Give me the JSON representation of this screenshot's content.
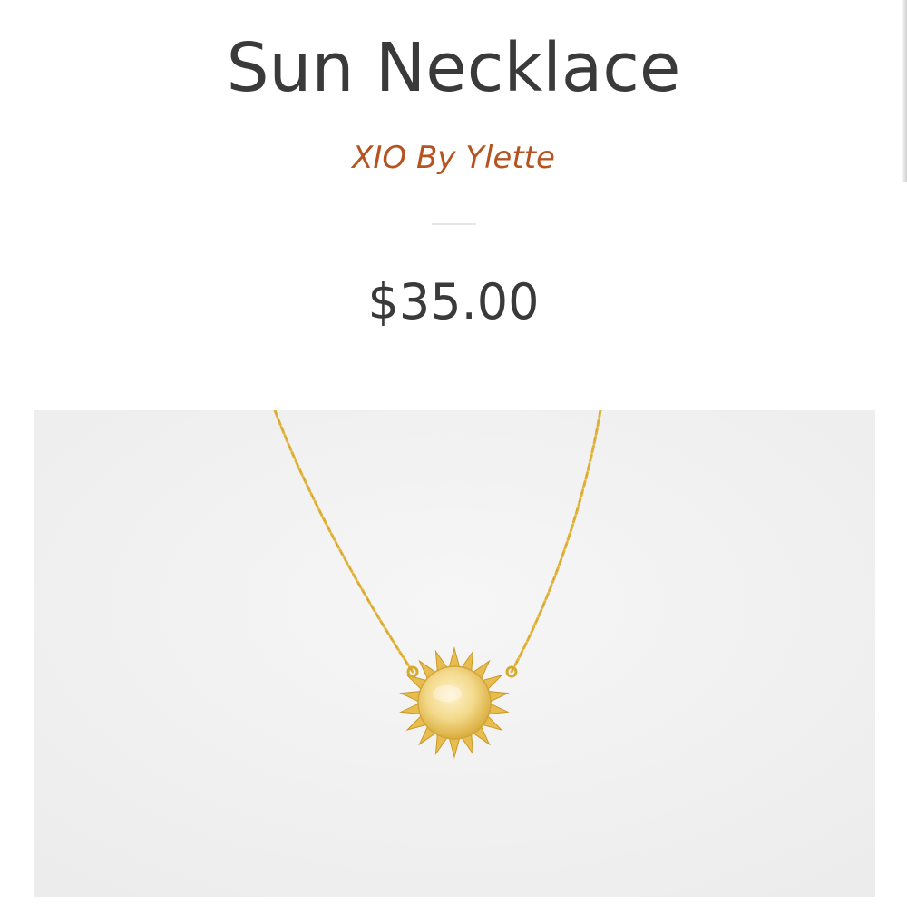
{
  "product": {
    "title": "Sun Necklace",
    "vendor": "XIO By Ylette",
    "price": "$35.00"
  },
  "image": {
    "subject": "sun-necklace-photo",
    "background_color": "#f1f1f1",
    "metal_color": "#e2b43a"
  },
  "colors": {
    "title": "#3a3a3a",
    "vendor_link": "#b65421",
    "divider": "#e6e6e6"
  }
}
